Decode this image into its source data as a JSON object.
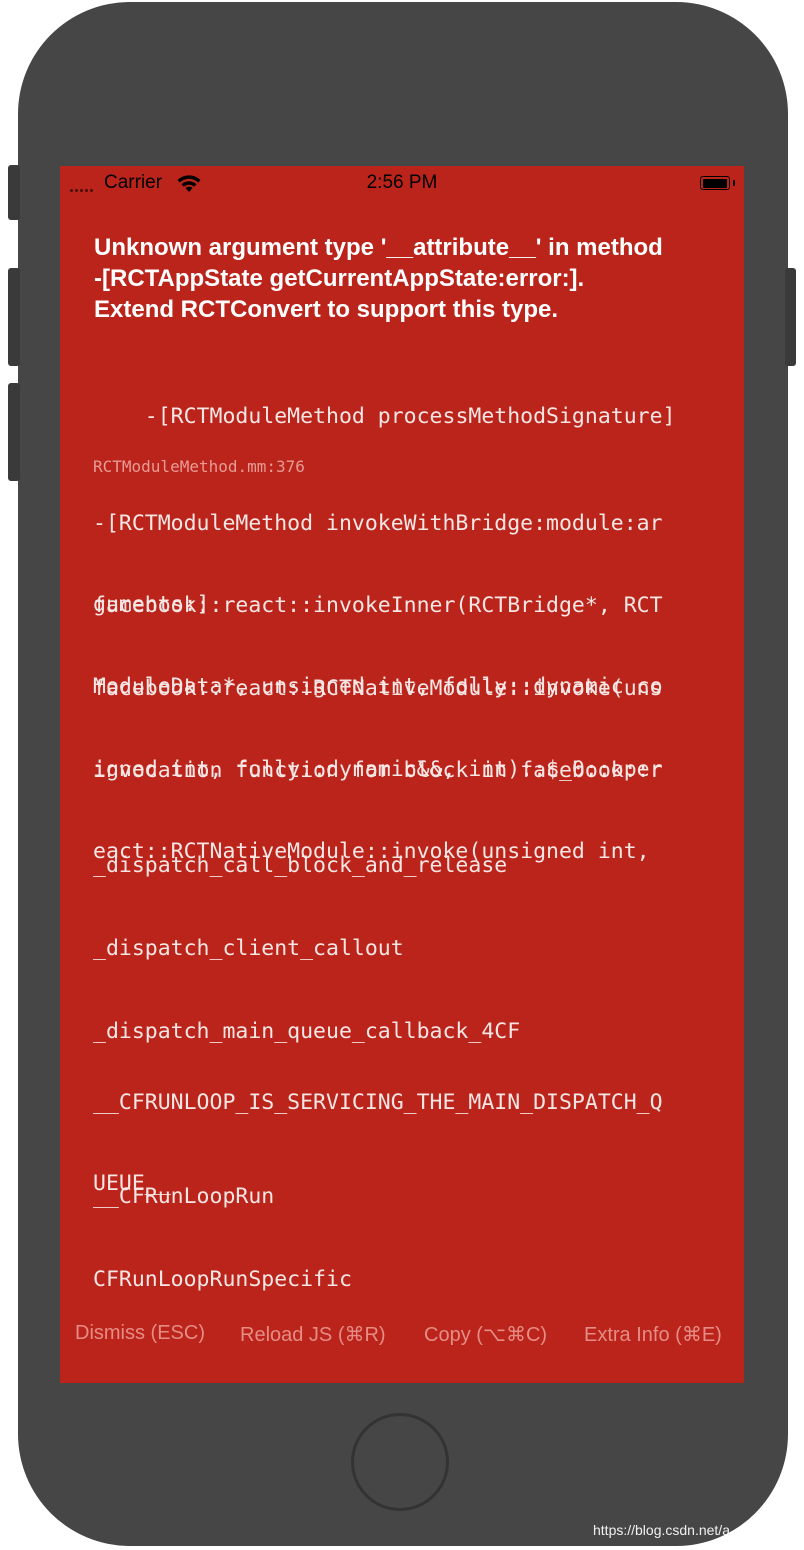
{
  "status_bar": {
    "carrier": "Carrier",
    "time": "2:56 PM"
  },
  "error": {
    "title_lines": [
      "Unknown argument type '__attribute__' in method",
      "-[RCTAppState getCurrentAppState:error:].",
      "Extend RCTConvert to support this type."
    ]
  },
  "stack": [
    {
      "lines": [
        "-[RCTModuleMethod processMethodSignature]"
      ],
      "location": "RCTModuleMethod.mm:376"
    },
    {
      "lines": [
        "-[RCTModuleMethod invokeWithBridge:module:ar",
        "guments:]"
      ]
    },
    {
      "lines": [
        "facebook::react::invokeInner(RCTBridge*, RCT",
        "ModuleData*, unsigned int, folly::dynamic co"
      ]
    },
    {
      "lines": [
        "facebook::react::RCTNativeModule::invoke(uns",
        "igned int, folly::dynamic&&, int)::$_0::oper"
      ]
    },
    {
      "lines": [
        "invocation function for block in facebook::r",
        "eact::RCTNativeModule::invoke(unsigned int,"
      ]
    },
    {
      "lines": [
        "_dispatch_call_block_and_release"
      ]
    },
    {
      "lines": [
        "_dispatch_client_callout"
      ]
    },
    {
      "lines": [
        "_dispatch_main_queue_callback_4CF"
      ]
    },
    {
      "lines": [
        "__CFRUNLOOP_IS_SERVICING_THE_MAIN_DISPATCH_Q",
        "UEUE__"
      ]
    },
    {
      "lines": [
        "__CFRunLoopRun"
      ]
    },
    {
      "lines": [
        "CFRunLoopRunSpecific"
      ]
    }
  ],
  "buttons": {
    "dismiss": "Dismiss (ESC)",
    "reload": "Reload JS (⌘R)",
    "copy": "Copy (⌥⌘C)",
    "extra": "Extra Info (⌘E)"
  },
  "watermark": "https://blog.csdn.net/a",
  "colors": {
    "background": "#bb241b",
    "button_text": "#e58c85",
    "phone_body": "#464646"
  }
}
